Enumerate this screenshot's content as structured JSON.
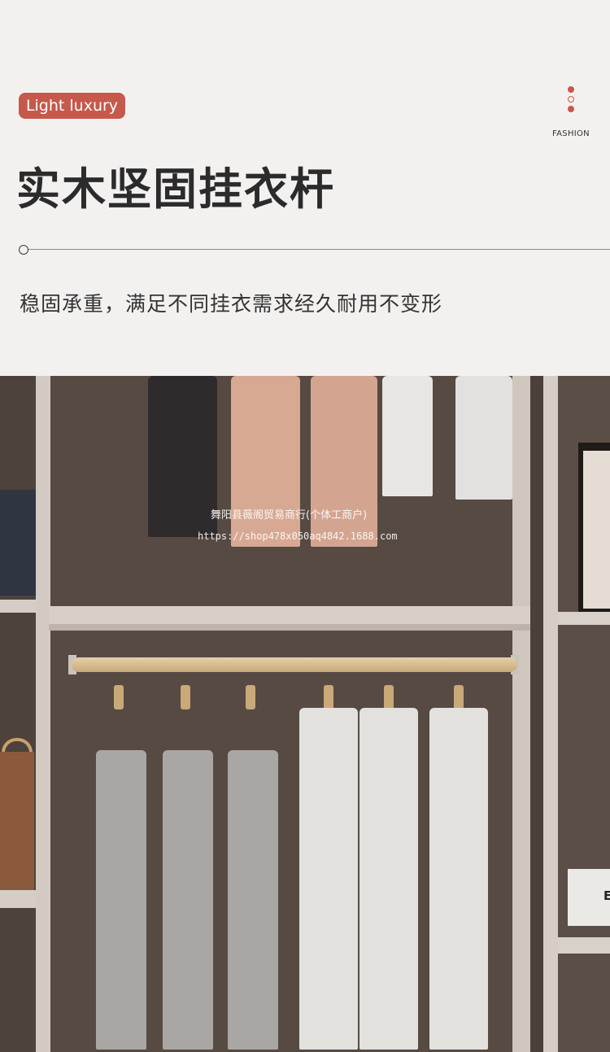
{
  "header": {
    "tag": "Light luxury",
    "fashion_label": "FASHION",
    "title": "实木坚固挂衣杆",
    "subtitle": "稳固承重，满足不同挂衣需求经久耐用不变形"
  },
  "watermark": {
    "shop_name": "舞阳县薇阁贸易商行(个体工商户)",
    "shop_url": "https://shop478x050aq4842.1688.com"
  },
  "photo": {
    "description_icon": "wardrobe-photo",
    "box_label": "E"
  },
  "colors": {
    "accent": "#c6594b",
    "background": "#f3f1f0",
    "title_text": "#2b2b2b",
    "body_text": "#333333"
  }
}
